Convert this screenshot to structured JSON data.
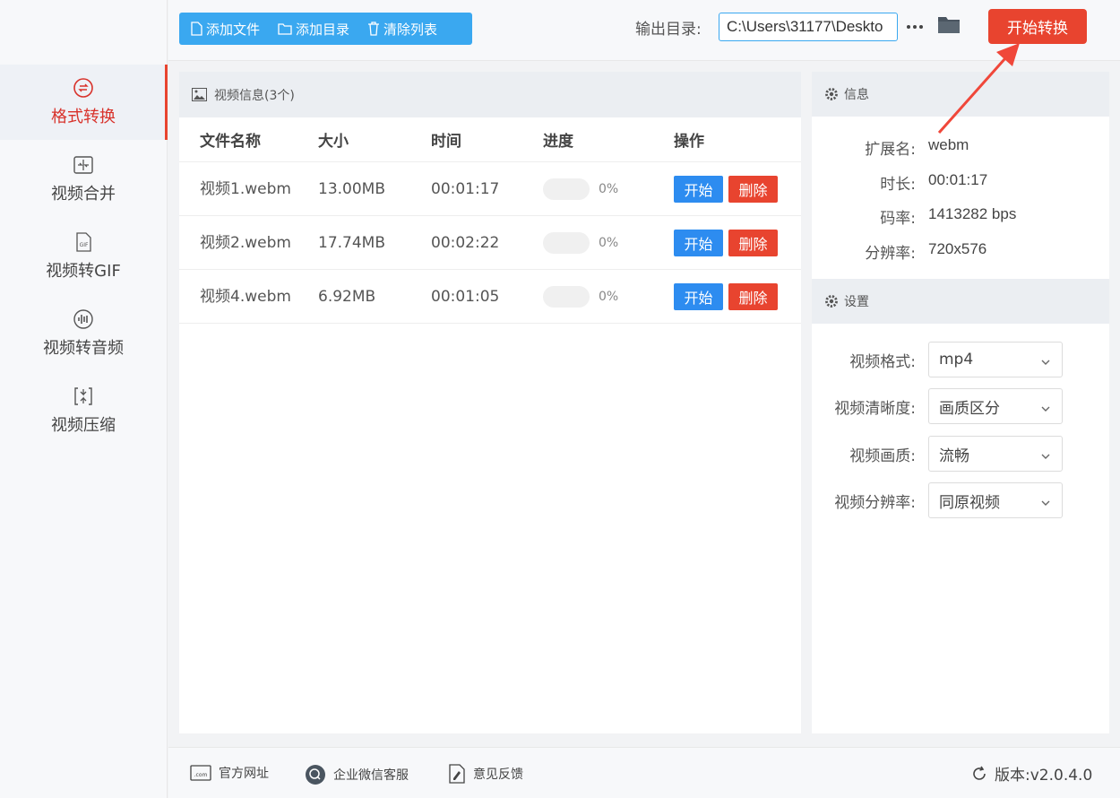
{
  "sidebar": {
    "items": [
      {
        "label": "格式转换",
        "icon": "format-convert-icon",
        "active": true
      },
      {
        "label": "视频合并",
        "icon": "merge-icon",
        "active": false
      },
      {
        "label": "视频转GIF",
        "icon": "gif-icon",
        "active": false
      },
      {
        "label": "视频转音频",
        "icon": "audio-icon",
        "active": false
      },
      {
        "label": "视频压缩",
        "icon": "compress-icon",
        "active": false
      }
    ]
  },
  "toolbar": {
    "add_file": "添加文件",
    "add_dir": "添加目录",
    "clear_list": "清除列表",
    "output_label": "输出目录:",
    "output_path": "C:\\Users\\31177\\Deskto",
    "start_convert": "开始转换"
  },
  "video_panel": {
    "title": "视频信息(3个)",
    "columns": {
      "name": "文件名称",
      "size": "大小",
      "time": "时间",
      "progress": "进度",
      "ops": "操作"
    },
    "rows": [
      {
        "name": "视频1.webm",
        "size": "13.00MB",
        "time": "00:01:17",
        "progress": "0%",
        "start": "开始",
        "delete": "删除"
      },
      {
        "name": "视频2.webm",
        "size": "17.74MB",
        "time": "00:02:22",
        "progress": "0%",
        "start": "开始",
        "delete": "删除"
      },
      {
        "name": "视频4.webm",
        "size": "6.92MB",
        "time": "00:01:05",
        "progress": "0%",
        "start": "开始",
        "delete": "删除"
      }
    ]
  },
  "info_panel": {
    "title": "信息",
    "ext_label": "扩展名:",
    "ext_value": "webm",
    "duration_label": "时长:",
    "duration_value": "00:01:17",
    "bitrate_label": "码率:",
    "bitrate_value": "1413282 bps",
    "resolution_label": "分辨率:",
    "resolution_value": "720x576"
  },
  "settings_panel": {
    "title": "设置",
    "format_label": "视频格式:",
    "format_value": "mp4",
    "clarity_label": "视频清晰度:",
    "clarity_value": "画质区分",
    "quality_label": "视频画质:",
    "quality_value": "流畅",
    "resolution_label": "视频分辨率:",
    "resolution_value": "同原视频"
  },
  "footer": {
    "website": "官方网址",
    "wechat": "企业微信客服",
    "feedback": "意见反馈",
    "version": "版本:v2.0.4.0"
  },
  "colors": {
    "accent_blue": "#3aa8f0",
    "accent_red": "#e8442f",
    "start_blue": "#2d8cf0"
  }
}
